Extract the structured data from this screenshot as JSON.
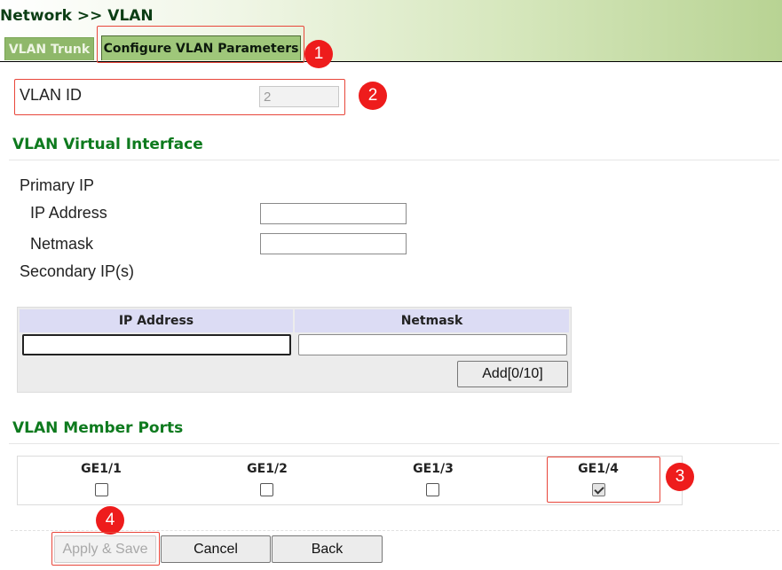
{
  "header": {
    "title": "Network >> VLAN",
    "tabs": [
      {
        "label": "VLAN Trunk",
        "active": false
      },
      {
        "label": "Configure VLAN Parameters",
        "active": true
      }
    ]
  },
  "vlan_id": {
    "label": "VLAN ID",
    "value": "2"
  },
  "virtual_interface": {
    "title": "VLAN Virtual Interface",
    "primary_ip_label": "Primary IP",
    "ip_address_label": "IP Address",
    "ip_address_value": "",
    "netmask_label": "Netmask",
    "netmask_value": "",
    "secondary_label": "Secondary IP(s)",
    "secondary_table": {
      "columns": [
        "IP Address",
        "Netmask"
      ],
      "rows": [
        {
          "ip": "",
          "netmask": ""
        }
      ],
      "add_button_label": "Add[0/10]"
    }
  },
  "member_ports": {
    "title": "VLAN Member Ports",
    "ports": [
      {
        "label": "GE1/1",
        "checked": false
      },
      {
        "label": "GE1/2",
        "checked": false
      },
      {
        "label": "GE1/3",
        "checked": false
      },
      {
        "label": "GE1/4",
        "checked": true
      }
    ]
  },
  "actions": {
    "apply_save_label": "Apply & Save",
    "cancel_label": "Cancel",
    "back_label": "Back"
  },
  "annotations": [
    "1",
    "2",
    "3",
    "4"
  ],
  "colors": {
    "accent_green": "#0e7a1e",
    "header_gradient_end": "#b8d393",
    "annotation_red": "#ee1c1c"
  }
}
